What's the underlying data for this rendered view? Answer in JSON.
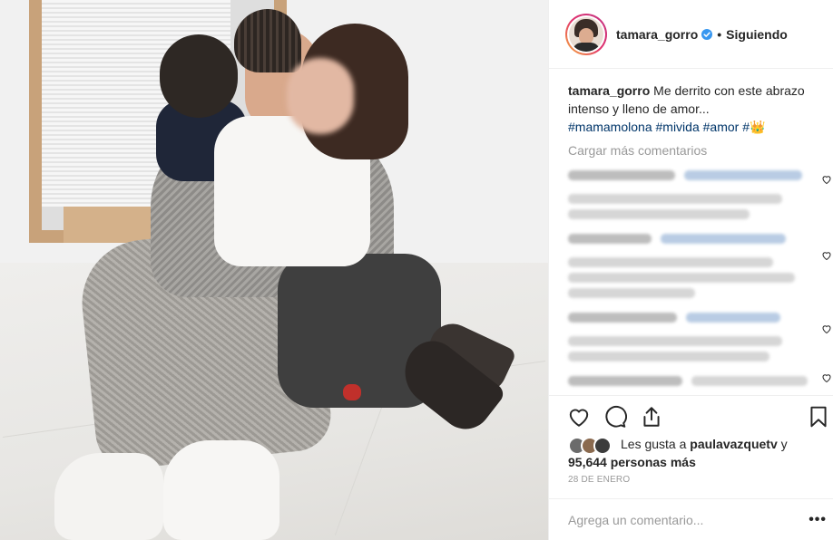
{
  "post": {
    "username": "tamara_gorro",
    "follow_status": "Siguiendo",
    "separator": "•",
    "caption": {
      "username": "tamara_gorro",
      "text": "Me derrito con este abrazo intenso y lleno de amor...",
      "hashtags": "#mamamolona #mivida #amor #",
      "emoji": "👑"
    },
    "load_more": "Cargar más comentarios",
    "likes": {
      "prefix": "Les gusta a ",
      "user": "paulavazquetv",
      "suffix": " y",
      "count_line": "95,644 personas más"
    },
    "date": "28 DE ENERO",
    "comment_placeholder": "Agrega un comentario...",
    "more_options": "•••"
  },
  "colors": {
    "link": "#003569",
    "muted": "#999999",
    "text": "#262626",
    "verified": "#3897f0",
    "border": "#efefef"
  },
  "icons": [
    "verified-badge-icon",
    "heart-icon",
    "comment-icon",
    "share-icon",
    "bookmark-icon",
    "comment-like-icon",
    "more-options-icon"
  ]
}
